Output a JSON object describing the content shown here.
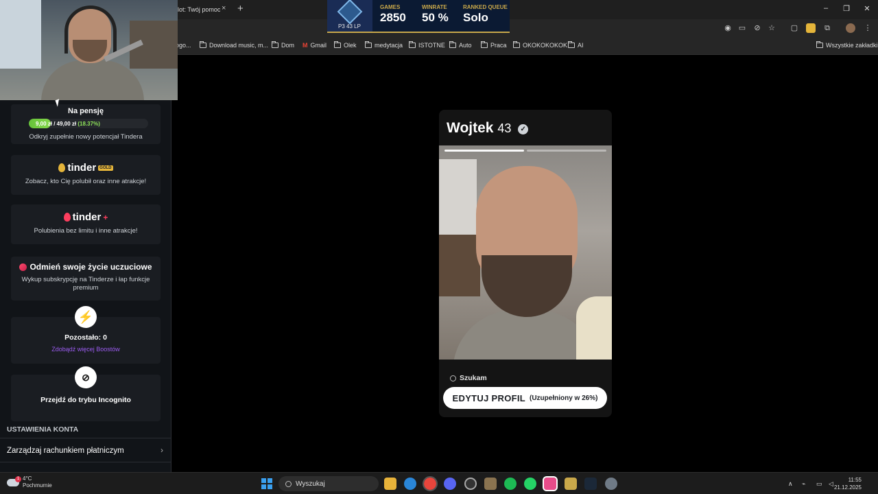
{
  "browser": {
    "tab_title": "lot: Twój pomoc",
    "tab_close": "×",
    "new_tab": "+",
    "window_controls": [
      "–",
      "❐",
      "✕"
    ],
    "bookmarks": [
      {
        "label": "ogo...",
        "icon": "page-icon"
      },
      {
        "label": "Download music, m...",
        "icon": "download-icon"
      },
      {
        "label": "Dom",
        "icon": "folder-icon"
      },
      {
        "label": "Gmail",
        "icon": "gmail-icon"
      },
      {
        "label": "Olek",
        "icon": "folder-icon"
      },
      {
        "label": "medytacja",
        "icon": "folder-icon"
      },
      {
        "label": "ISTOTNE",
        "icon": "folder-icon"
      },
      {
        "label": "Auto",
        "icon": "folder-icon"
      },
      {
        "label": "Praca",
        "icon": "folder-icon"
      },
      {
        "label": "OKOKOKOKOK",
        "icon": "folder-icon"
      },
      {
        "label": "AI",
        "icon": "folder-icon"
      }
    ],
    "all_bookmarks": "Wszystkie zakładki"
  },
  "overlay": {
    "rank_lp": "P3 43 LP",
    "stats": [
      {
        "label": "GAMES",
        "value": "2850"
      },
      {
        "label": "WINRATE",
        "value": "50 %"
      },
      {
        "label": "RANKED QUEUE",
        "value": "Solo"
      }
    ]
  },
  "sidebar": {
    "pension": {
      "title": "Na pensję",
      "amount": "9,00 zł / 49,00 zł",
      "percent_text": "(18.37%)",
      "progress_fraction": 0.1837,
      "desc": "Odkryj zupełnie nowy potencjał Tindera"
    },
    "gold": {
      "brand": "tinder",
      "badge": "GOLD",
      "desc": "Zobacz, kto Cię polubił oraz inne atrakcje!"
    },
    "plus": {
      "brand": "tinder",
      "desc": "Polubienia bez limitu i inne atrakcje!"
    },
    "change": {
      "title": "Odmień swoje życie uczuciowe",
      "desc": "Wykup subskrypcję na Tinderze i łap funkcje premium"
    },
    "boost": {
      "count": "Pozostało: 0",
      "link": "Zdobądź więcej Boostów"
    },
    "incognito": {
      "label": "Przejdź do trybu Incognito"
    },
    "section_header": "USTAWIENIA KONTA",
    "settings_row": "Zarządzaj rachunkiem płatniczym"
  },
  "profile": {
    "name": "Wojtek",
    "age": "43",
    "looking_label": "Szukam",
    "edit_label": "EDYTUJ PROFIL",
    "edit_pct": "(Uzupełniony w 26%)"
  },
  "taskbar": {
    "weather_temp": "4°C",
    "weather_desc": "Pochmurnie",
    "weather_badge": "1",
    "search_placeholder": "Wyszukaj",
    "time": "11:55",
    "date": "21.12.2025"
  },
  "colors": {
    "tinder_red": "#fd3e5e",
    "boost_purple": "#9b3df5",
    "progress_green": "#66c23a",
    "gold": "#e5b53a"
  }
}
